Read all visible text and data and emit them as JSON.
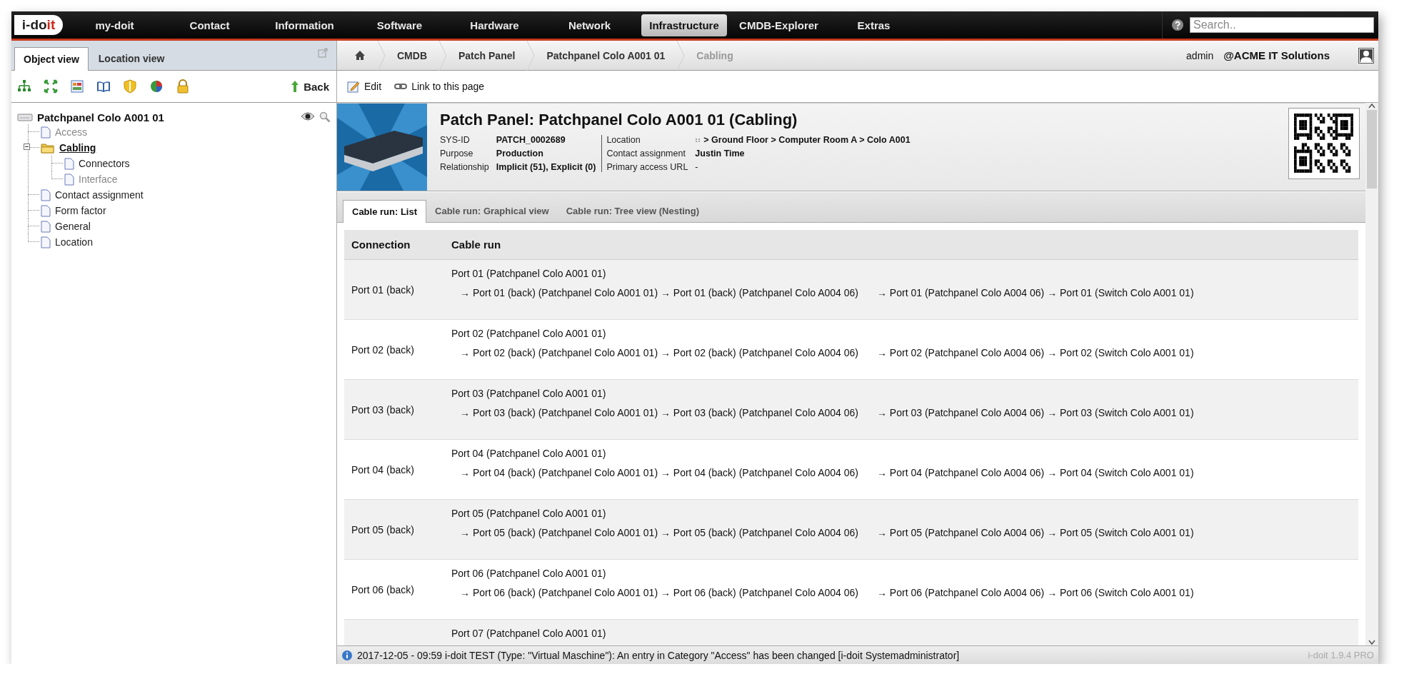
{
  "topbar": {
    "logo": {
      "text": "i-do",
      "accent": "it"
    },
    "nav": [
      {
        "label": "my-doit",
        "selected": false
      },
      {
        "label": "Contact",
        "selected": false
      },
      {
        "label": "Information",
        "selected": false
      },
      {
        "label": "Software",
        "selected": false
      },
      {
        "label": "Hardware",
        "selected": false
      },
      {
        "label": "Network",
        "selected": false
      },
      {
        "label": "Infrastructure",
        "selected": true
      },
      {
        "label": "CMDB-Explorer",
        "selected": false
      },
      {
        "label": "Extras",
        "selected": false
      }
    ],
    "search": {
      "placeholder": "Search.."
    }
  },
  "left_panel": {
    "tabs": [
      {
        "label": "Object view",
        "selected": true
      },
      {
        "label": "Location view",
        "selected": false
      }
    ],
    "back": "Back",
    "tree": {
      "label": "Patchpanel Colo A001 01",
      "children": [
        {
          "label": "Access",
          "kind": "page",
          "muted": true,
          "selected": false
        },
        {
          "label": "Cabling",
          "kind": "folder",
          "muted": false,
          "selected": true,
          "expanded": true,
          "children": [
            {
              "label": "Connectors",
              "kind": "page",
              "muted": false,
              "selected": false
            },
            {
              "label": "Interface",
              "kind": "page",
              "muted": true,
              "selected": false
            }
          ]
        },
        {
          "label": "Contact assignment",
          "kind": "page",
          "muted": false,
          "selected": false
        },
        {
          "label": "Form factor",
          "kind": "page",
          "muted": false,
          "selected": false
        },
        {
          "label": "General",
          "kind": "page",
          "muted": false,
          "selected": false
        },
        {
          "label": "Location",
          "kind": "page",
          "muted": false,
          "selected": false
        }
      ]
    }
  },
  "breadcrumb": [
    {
      "label": "CMDB",
      "current": false
    },
    {
      "label": "Patch Panel",
      "current": false
    },
    {
      "label": "Patchpanel Colo A001 01",
      "current": false
    },
    {
      "label": "Cabling",
      "current": true
    }
  ],
  "user": {
    "name": "admin",
    "tenant": "@ACME IT Solutions"
  },
  "actions": [
    {
      "kind": "edit",
      "label": "Edit"
    },
    {
      "kind": "link",
      "label": "Link to this page"
    }
  ],
  "object": {
    "title": "Patch Panel: Patchpanel Colo A001 01 (Cabling)",
    "fields_left": [
      {
        "label": "SYS-ID",
        "value": "PATCH_0002689"
      },
      {
        "label": "Purpose",
        "value": "Production"
      },
      {
        "label": "Relationship",
        "value": "Implicit (51), Explicit (0)"
      }
    ],
    "fields_right": [
      {
        "label": "Location",
        "value": "> Ground Floor > Computer Room A > Colo A001",
        "kind": "location"
      },
      {
        "label": "Contact assignment",
        "value": "Justin Time",
        "kind": "text"
      },
      {
        "label": "Primary access URL",
        "value": "-",
        "kind": "plain"
      }
    ]
  },
  "cable_tabs": [
    {
      "label": "Cable run: List",
      "selected": true
    },
    {
      "label": "Cable run: Graphical view",
      "selected": false
    },
    {
      "label": "Cable run: Tree view (Nesting)",
      "selected": false
    }
  ],
  "cable_table": {
    "columns": [
      "Connection",
      "Cable run"
    ],
    "rows": [
      {
        "connection": "Port 01 (back)",
        "start": "Port 01 (Patchpanel Colo A001 01)",
        "segments": [
          "→ Port 01 (back) (Patchpanel Colo A001 01) → Port 01 (back) (Patchpanel Colo A004 06)",
          "→ Port 01 (Patchpanel Colo A004 06) → Port 01 (Switch Colo A001 01)"
        ]
      },
      {
        "connection": "Port 02 (back)",
        "start": "Port 02 (Patchpanel Colo A001 01)",
        "segments": [
          "→ Port 02 (back) (Patchpanel Colo A001 01) → Port 02 (back) (Patchpanel Colo A004 06)",
          "→ Port 02 (Patchpanel Colo A004 06) → Port 02 (Switch Colo A001 01)"
        ]
      },
      {
        "connection": "Port 03 (back)",
        "start": "Port 03 (Patchpanel Colo A001 01)",
        "segments": [
          "→ Port 03 (back) (Patchpanel Colo A001 01) → Port 03 (back) (Patchpanel Colo A004 06)",
          "→ Port 03 (Patchpanel Colo A004 06) → Port 03 (Switch Colo A001 01)"
        ]
      },
      {
        "connection": "Port 04 (back)",
        "start": "Port 04 (Patchpanel Colo A001 01)",
        "segments": [
          "→ Port 04 (back) (Patchpanel Colo A001 01) → Port 04 (back) (Patchpanel Colo A004 06)",
          "→ Port 04 (Patchpanel Colo A004 06) → Port 04 (Switch Colo A001 01)"
        ]
      },
      {
        "connection": "Port 05 (back)",
        "start": "Port 05 (Patchpanel Colo A001 01)",
        "segments": [
          "→ Port 05 (back) (Patchpanel Colo A001 01) → Port 05 (back) (Patchpanel Colo A004 06)",
          "→ Port 05 (Patchpanel Colo A004 06) → Port 05 (Switch Colo A001 01)"
        ]
      },
      {
        "connection": "Port 06 (back)",
        "start": "Port 06 (Patchpanel Colo A001 01)",
        "segments": [
          "→ Port 06 (back) (Patchpanel Colo A001 01) → Port 06 (back) (Patchpanel Colo A004 06)",
          "→ Port 06 (Patchpanel Colo A004 06) → Port 06 (Switch Colo A001 01)"
        ]
      },
      {
        "start": "Port 07 (Patchpanel Colo A001 01)"
      }
    ]
  },
  "status_bar": {
    "message": "2017-12-05 - 09:59 i-doit TEST (Type: \"Virtual Maschine\"): An entry in Category \"Access\" has been changed [i-doit Systemadministrator]",
    "version": "i-doit 1.9.4 PRO"
  }
}
